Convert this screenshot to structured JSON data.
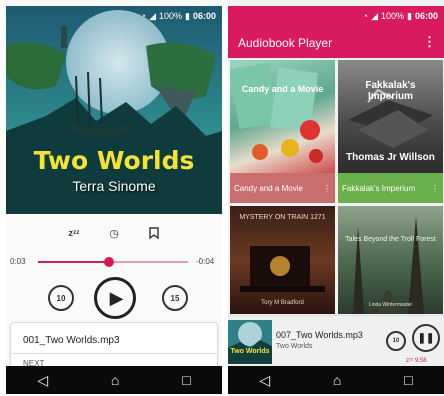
{
  "status": {
    "time": "06:00",
    "battery": "100%"
  },
  "now_playing": {
    "cover_title": "Two Worlds",
    "cover_author": "Terra Sinome",
    "elapsed": "0:03",
    "remaining": "-0:04",
    "progress": 0.47,
    "skip_back_seconds": "10",
    "skip_forward_seconds": "15",
    "current_file": "001_Two Worlds.mp3",
    "next_label": "NEXT"
  },
  "library": {
    "title": "Audiobook Player",
    "books": [
      {
        "name": "Candy and a Movie",
        "cover_text": "Candy and a Movie",
        "footer_color": "#c96e6e"
      },
      {
        "name": "Fakkalak's Imperium",
        "cover_text": "Fakkalak's Imperium",
        "cover_author": "Thomas Jr Willson",
        "footer_color": "#69b04a"
      },
      {
        "name": "",
        "cover_text": "MYSTERY ON TRAIN 1271",
        "cover_author": "Tory M Bradford"
      },
      {
        "name": "",
        "cover_text": "Tales Beyond the Troll Forest",
        "cover_author": "Linda Wintermaster"
      }
    ],
    "mini_player": {
      "title": "007_Two Worlds.mp3",
      "subtitle": "Two Worlds",
      "art_title": "Two Worlds",
      "skip_back_seconds": "10",
      "sleep_timer": "9:58"
    }
  },
  "colors": {
    "accent": "#d81b60",
    "seek": "#d81b4f"
  }
}
